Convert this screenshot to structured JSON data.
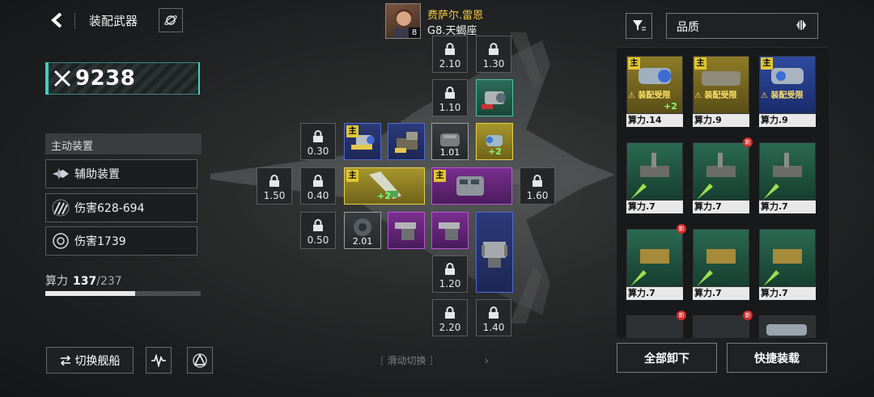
{
  "header": {
    "title": "装配武器"
  },
  "combat_power": "9238",
  "active_gear": {
    "heading": "主动装置",
    "items": [
      {
        "label": "辅助装置",
        "icon": "jet-icon"
      },
      {
        "label": "伤害628-694",
        "icon": "claw-icon"
      },
      {
        "label": "伤害1739",
        "icon": "burst-icon"
      }
    ]
  },
  "compute": {
    "label": "算力",
    "current": "137",
    "total": "/237",
    "fraction": 0.578
  },
  "bottom_left": {
    "switch_label": "切换舰船"
  },
  "pilot": {
    "name": "费萨尔.雷恩",
    "sub": "G8.天蝎座",
    "level": "8"
  },
  "slots": {
    "locked": [
      "2.10",
      "1.30",
      "1.10",
      "0.30",
      "1.50",
      "0.40",
      "1.60",
      "0.50",
      "1.20",
      "2.20",
      "1.40"
    ],
    "main_tag": "主",
    "plus_a": "+2",
    "plus_b": "+2",
    "equipped_num_a": "1.01",
    "equipped_num_b": "2.01"
  },
  "swipe_hint": "滑动切换",
  "right_panel": {
    "sort_label": "品质",
    "cards": [
      {
        "label": "算力.14",
        "warn": "装配受限",
        "plus": "+2",
        "main": "主"
      },
      {
        "label": "算力.9",
        "warn": "装配受限",
        "main": "主"
      },
      {
        "label": "算力.9",
        "warn": "装配受限",
        "main": "主"
      },
      {
        "label": "算力.7"
      },
      {
        "label": "算力.7",
        "new": "新"
      },
      {
        "label": "算力.7"
      },
      {
        "label": "算力.7",
        "new": "新"
      },
      {
        "label": "算力.7"
      },
      {
        "label": "算力.7"
      }
    ],
    "new_tag": "新",
    "unequip_all": "全部卸下",
    "quick_equip": "快捷装载"
  },
  "colors": {
    "accent_teal": "#3fd1c2",
    "pilot_name": "#f4c542",
    "rarity_blue": "#4f69d1",
    "rarity_gold": "#e8d14a",
    "rarity_purple": "#c050e0",
    "rarity_green": "#49c79a"
  }
}
